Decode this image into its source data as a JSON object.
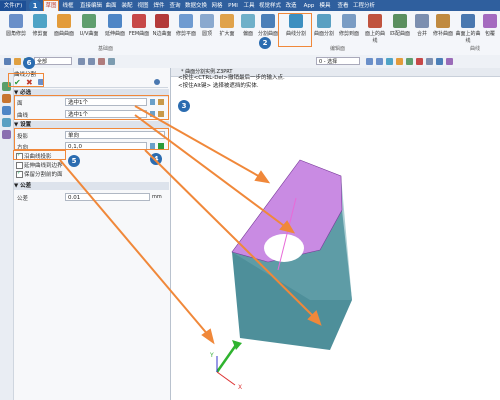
{
  "tabs": [
    "文件(F)",
    "草图",
    "线框",
    "直接编辑",
    "曲面",
    "装配",
    "视图",
    "焊件",
    "查询",
    "数据交换",
    "网格",
    "PMI",
    "工具",
    "视觉样式",
    "改造",
    "App",
    "模具",
    "查看",
    "工程分析"
  ],
  "active_tab": "草图",
  "ribbon": {
    "buttons": [
      "圆角修剪",
      "修剪面",
      "面曲曲面",
      "U/V曲面",
      "延伸曲面",
      "FEM曲面",
      "N边曲面",
      "修剪平面",
      "圆顶",
      "扩大面",
      "偏面",
      "分割曲面",
      "曲线分割",
      "曲面分割",
      "修剪到面",
      "面上的曲线",
      "匹配曲面",
      "合并",
      "修补曲面",
      "曲面上的曲线",
      "包覆",
      "延伸曲面"
    ],
    "group1": "基础面",
    "group2": "编辑面",
    "group3": "曲线"
  },
  "selector": {
    "value": "全部",
    "filter": "0 - 选择"
  },
  "panel": {
    "title": "曲线分割",
    "section_required": "必选",
    "face_label": "面",
    "face_value": "选中1个",
    "curve_label": "曲线",
    "curve_value": "选中1个",
    "section_settings": "设置",
    "proj_label": "投影",
    "proj_value": "单向",
    "dir_label": "方向",
    "dir_value": "0,1,0",
    "chk1": "沿曲线投影",
    "chk2": "延伸曲线到边界",
    "chk3": "保留分割前的面",
    "section_tol": "公差",
    "tol_label": "公差",
    "tol_value": "0.01",
    "tol_unit": "mm"
  },
  "doc_tab": "* 曲面分割实例.Z3PRT",
  "hint_line1": "<按住<CTRL-Del>撤销最后一步的输入点.",
  "hint_line2": "<按住Alt键> 选择被遮挡的实体.",
  "callouts": [
    "1",
    "2",
    "3",
    "4",
    "5",
    "6"
  ],
  "axis": {
    "y": "Y",
    "x": "X"
  },
  "colors": {
    "accent": "#f0883a",
    "callout": "#2b6cb0",
    "surface": "#4e8f9a",
    "top_face": "#c98be3"
  }
}
